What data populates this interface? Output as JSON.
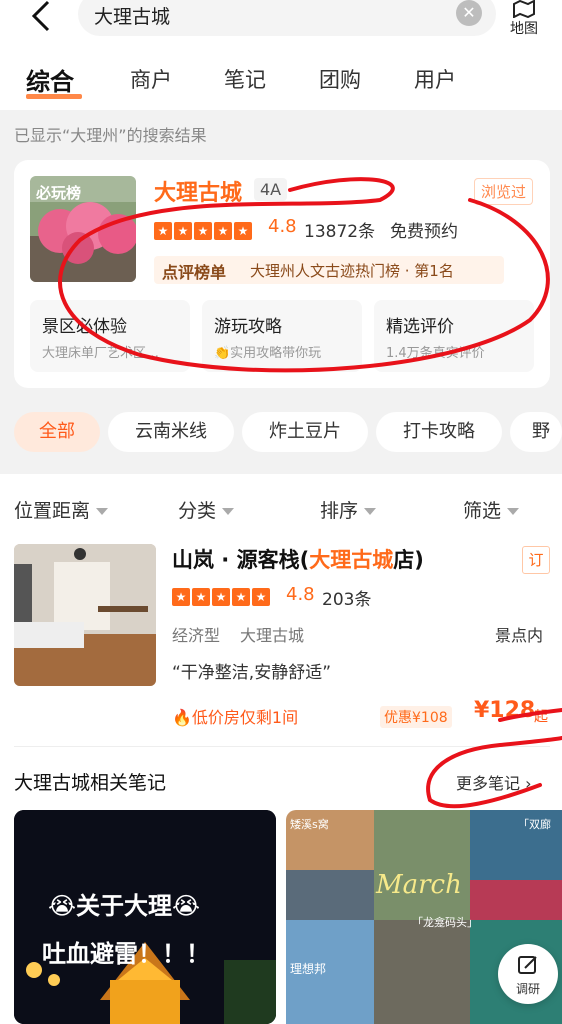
{
  "search": {
    "query": "大理古城",
    "map_label": "地图"
  },
  "tabs": [
    "综合",
    "商户",
    "笔记",
    "团购",
    "用户"
  ],
  "result_hint": "已显示“大理州”的搜索结果",
  "poi": {
    "thumb_badge": "必玩榜",
    "name": "大理古城",
    "level": "4A",
    "viewed": "浏览过",
    "score": "4.8",
    "reviews": "13872条",
    "booking": "免费预约",
    "rank_title": "点评榜单",
    "rank_text": "大理州人文古迹热门榜 · 第1名",
    "subcards": [
      {
        "title": "景区必体验",
        "desc": "大理床单厂艺术区…"
      },
      {
        "title": "游玩攻略",
        "desc": "👏实用攻略带你玩"
      },
      {
        "title": "精选评价",
        "desc": "1.4万条真实评价"
      }
    ]
  },
  "chips": [
    "全部",
    "云南米线",
    "炸土豆片",
    "打卡攻略",
    "野生"
  ],
  "filters": [
    "位置距离",
    "分类",
    "排序",
    "筛选"
  ],
  "hotel": {
    "name_prefix": "山岚 · 源客栈(",
    "name_highlight": "大理古城",
    "name_suffix": "店)",
    "book_tag": "订",
    "score": "4.8",
    "reviews": "203条",
    "type": "经济型",
    "area": "大理古城",
    "scenic": "景点内",
    "quote": "“干净整洁,安静舒适”",
    "deal": "🔥低价房仅剩1间",
    "discount": "优惠¥108",
    "price": "¥128",
    "price_suffix": "起"
  },
  "notes": {
    "title": "大理古城相关笔记",
    "more": "更多笔记 ›",
    "card1_title": "😭关于大理😭",
    "card1_sub": "吐血避雷！！！",
    "card2_labels": [
      "矮溪s窝",
      "March",
      "「双廊",
      "「龙龛码头」",
      "理想邦"
    ]
  },
  "feedback_label": "调研",
  "colors": {
    "accent": "#ff6a1a",
    "annotation": "#e8121a"
  }
}
